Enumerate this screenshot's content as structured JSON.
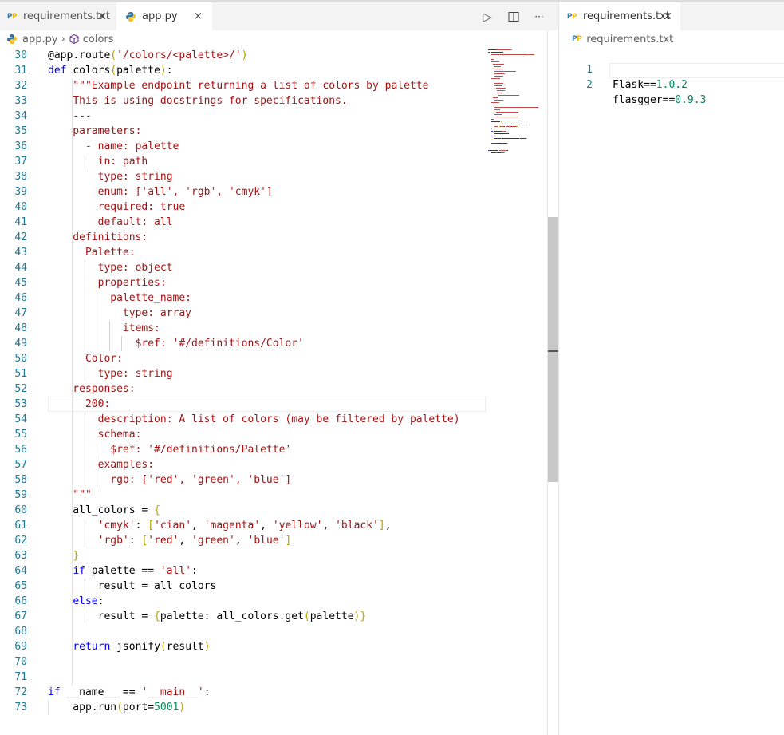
{
  "left_group": {
    "tabs": [
      {
        "label": "requirements.txt",
        "icon": "pip-icon",
        "close": "×",
        "active": false
      },
      {
        "label": "app.py",
        "icon": "python-icon",
        "close": "×",
        "active": true
      }
    ],
    "actions": {
      "run": "▷",
      "split": "⧉",
      "more": "···"
    },
    "breadcrumb": {
      "file": "app.py",
      "separator": "›",
      "symbol": "colors"
    }
  },
  "right_group": {
    "tab": {
      "label": "requirements.txt",
      "icon": "pip-icon",
      "close": "×"
    },
    "breadcrumb": {
      "file": "requirements.txt"
    },
    "lines": [
      {
        "num": "1",
        "name": "Flask",
        "op": "==",
        "ver": "1.0.2"
      },
      {
        "num": "2",
        "name": "flasgger",
        "op": "==",
        "ver": "0.9.3"
      }
    ]
  },
  "editor": {
    "lines": [
      {
        "num": "30",
        "tokens": [
          {
            "t": "@app.route",
            "c": ""
          },
          {
            "t": "(",
            "c": "b"
          },
          {
            "t": "'/colors/<palette>/'",
            "c": "s"
          },
          {
            "t": ")",
            "c": "b"
          }
        ]
      },
      {
        "num": "31",
        "tokens": [
          {
            "t": "def ",
            "c": "k"
          },
          {
            "t": "colors",
            "c": ""
          },
          {
            "t": "(",
            "c": "b"
          },
          {
            "t": "palette",
            "c": ""
          },
          {
            "t": ")",
            "c": "b"
          },
          {
            "t": ":",
            "c": ""
          }
        ]
      },
      {
        "num": "32",
        "tokens": [
          {
            "t": "    \"\"\"Example endpoint returning a list of colors by palette",
            "c": "s"
          }
        ]
      },
      {
        "num": "33",
        "tokens": [
          {
            "t": "    This is using docstrings for specifications.",
            "c": "s"
          }
        ]
      },
      {
        "num": "34",
        "tokens": [
          {
            "t": "    ---",
            "c": "s"
          }
        ]
      },
      {
        "num": "35",
        "tokens": [
          {
            "t": "    parameters:",
            "c": "s"
          }
        ]
      },
      {
        "num": "36",
        "tokens": [
          {
            "t": "      - name: palette",
            "c": "s"
          }
        ]
      },
      {
        "num": "37",
        "tokens": [
          {
            "t": "        in: path",
            "c": "s"
          }
        ]
      },
      {
        "num": "38",
        "tokens": [
          {
            "t": "        type: string",
            "c": "s"
          }
        ]
      },
      {
        "num": "39",
        "tokens": [
          {
            "t": "        enum: ['all', 'rgb', 'cmyk']",
            "c": "s"
          }
        ]
      },
      {
        "num": "40",
        "tokens": [
          {
            "t": "        required: true",
            "c": "s"
          }
        ]
      },
      {
        "num": "41",
        "tokens": [
          {
            "t": "        default: all",
            "c": "s"
          }
        ]
      },
      {
        "num": "42",
        "tokens": [
          {
            "t": "    definitions:",
            "c": "s"
          }
        ]
      },
      {
        "num": "43",
        "tokens": [
          {
            "t": "      Palette:",
            "c": "s"
          }
        ]
      },
      {
        "num": "44",
        "tokens": [
          {
            "t": "        type: object",
            "c": "s"
          }
        ]
      },
      {
        "num": "45",
        "tokens": [
          {
            "t": "        properties:",
            "c": "s"
          }
        ]
      },
      {
        "num": "46",
        "tokens": [
          {
            "t": "          palette_name:",
            "c": "s"
          }
        ]
      },
      {
        "num": "47",
        "tokens": [
          {
            "t": "            type: array",
            "c": "s"
          }
        ]
      },
      {
        "num": "48",
        "tokens": [
          {
            "t": "            items:",
            "c": "s"
          }
        ]
      },
      {
        "num": "49",
        "tokens": [
          {
            "t": "              $ref: '#/definitions/Color'",
            "c": "s"
          }
        ]
      },
      {
        "num": "50",
        "tokens": [
          {
            "t": "      Color:",
            "c": "s"
          }
        ]
      },
      {
        "num": "51",
        "tokens": [
          {
            "t": "        type: string",
            "c": "s"
          }
        ]
      },
      {
        "num": "52",
        "tokens": [
          {
            "t": "    responses:",
            "c": "s"
          }
        ]
      },
      {
        "num": "53",
        "tokens": [
          {
            "t": "      200:",
            "c": "s"
          }
        ]
      },
      {
        "num": "54",
        "tokens": [
          {
            "t": "        description: A list of colors (may be filtered by palette)",
            "c": "s"
          }
        ]
      },
      {
        "num": "55",
        "tokens": [
          {
            "t": "        schema:",
            "c": "s"
          }
        ]
      },
      {
        "num": "56",
        "tokens": [
          {
            "t": "          $ref: '#/definitions/Palette'",
            "c": "s"
          }
        ]
      },
      {
        "num": "57",
        "tokens": [
          {
            "t": "        examples:",
            "c": "s"
          }
        ]
      },
      {
        "num": "58",
        "tokens": [
          {
            "t": "          rgb: ['red', 'green', 'blue']",
            "c": "s"
          }
        ]
      },
      {
        "num": "59",
        "tokens": [
          {
            "t": "    \"\"\"",
            "c": "s"
          }
        ]
      },
      {
        "num": "60",
        "tokens": [
          {
            "t": "    all_colors = ",
            "c": ""
          },
          {
            "t": "{",
            "c": "b"
          }
        ]
      },
      {
        "num": "61",
        "tokens": [
          {
            "t": "        ",
            "c": ""
          },
          {
            "t": "'cmyk'",
            "c": "s"
          },
          {
            "t": ": ",
            "c": ""
          },
          {
            "t": "[",
            "c": "b"
          },
          {
            "t": "'cian'",
            "c": "s"
          },
          {
            "t": ", ",
            "c": ""
          },
          {
            "t": "'magenta'",
            "c": "s"
          },
          {
            "t": ", ",
            "c": ""
          },
          {
            "t": "'yellow'",
            "c": "s"
          },
          {
            "t": ", ",
            "c": ""
          },
          {
            "t": "'black'",
            "c": "s"
          },
          {
            "t": "]",
            "c": "b"
          },
          {
            "t": ",",
            "c": ""
          }
        ]
      },
      {
        "num": "62",
        "tokens": [
          {
            "t": "        ",
            "c": ""
          },
          {
            "t": "'rgb'",
            "c": "s"
          },
          {
            "t": ": ",
            "c": ""
          },
          {
            "t": "[",
            "c": "b"
          },
          {
            "t": "'red'",
            "c": "s"
          },
          {
            "t": ", ",
            "c": ""
          },
          {
            "t": "'green'",
            "c": "s"
          },
          {
            "t": ", ",
            "c": ""
          },
          {
            "t": "'blue'",
            "c": "s"
          },
          {
            "t": "]",
            "c": "b"
          }
        ]
      },
      {
        "num": "63",
        "tokens": [
          {
            "t": "    ",
            "c": ""
          },
          {
            "t": "}",
            "c": "b"
          }
        ]
      },
      {
        "num": "64",
        "tokens": [
          {
            "t": "    ",
            "c": ""
          },
          {
            "t": "if",
            "c": "k"
          },
          {
            "t": " palette == ",
            "c": ""
          },
          {
            "t": "'all'",
            "c": "s"
          },
          {
            "t": ":",
            "c": ""
          }
        ]
      },
      {
        "num": "65",
        "tokens": [
          {
            "t": "        result = all_colors",
            "c": ""
          }
        ]
      },
      {
        "num": "66",
        "tokens": [
          {
            "t": "    ",
            "c": ""
          },
          {
            "t": "else",
            "c": "k"
          },
          {
            "t": ":",
            "c": ""
          }
        ]
      },
      {
        "num": "67",
        "tokens": [
          {
            "t": "        result = ",
            "c": ""
          },
          {
            "t": "{",
            "c": "b"
          },
          {
            "t": "palette: all_colors.get",
            "c": ""
          },
          {
            "t": "(",
            "c": "b"
          },
          {
            "t": "palette",
            "c": ""
          },
          {
            "t": ")",
            "c": "b"
          },
          {
            "t": "}",
            "c": "b"
          }
        ]
      },
      {
        "num": "68",
        "tokens": []
      },
      {
        "num": "69",
        "tokens": [
          {
            "t": "    ",
            "c": ""
          },
          {
            "t": "return",
            "c": "k"
          },
          {
            "t": " jsonify",
            "c": ""
          },
          {
            "t": "(",
            "c": "b"
          },
          {
            "t": "result",
            "c": ""
          },
          {
            "t": ")",
            "c": "b"
          }
        ]
      },
      {
        "num": "70",
        "tokens": []
      },
      {
        "num": "71",
        "tokens": []
      },
      {
        "num": "72",
        "tokens": [
          {
            "t": "if",
            "c": "k"
          },
          {
            "t": " __name__ == ",
            "c": ""
          },
          {
            "t": "'__main__'",
            "c": "s"
          },
          {
            "t": ":",
            "c": ""
          }
        ]
      },
      {
        "num": "73",
        "tokens": [
          {
            "t": "    app.run",
            "c": ""
          },
          {
            "t": "(",
            "c": "b"
          },
          {
            "t": "port=",
            "c": ""
          },
          {
            "t": "5001",
            "c": "n"
          },
          {
            "t": ")",
            "c": "b"
          }
        ]
      }
    ]
  }
}
